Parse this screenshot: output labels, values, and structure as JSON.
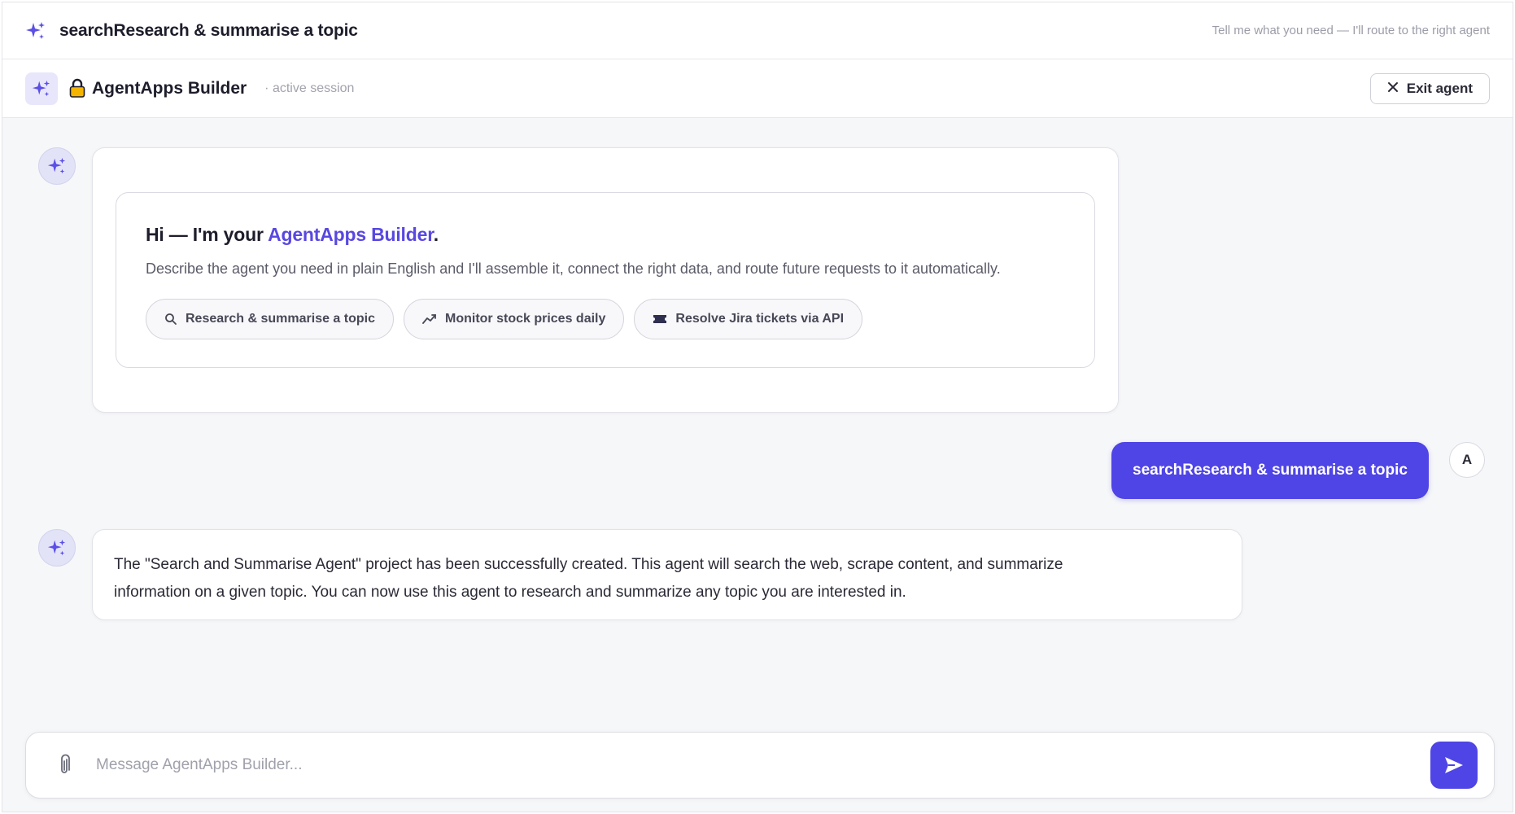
{
  "topbar": {
    "title": "searchResearch & summarise a topic",
    "hint": "Tell me what you need — I'll route to the right agent",
    "icon": "sparkle-icon"
  },
  "agentbar": {
    "agent_icon": "sparkle-icon",
    "lock_icon": "lock-icon",
    "name": "AgentApps Builder",
    "session": "· active session",
    "exit_label": "Exit agent",
    "exit_icon": "close-icon"
  },
  "welcome": {
    "title_prefix": "Hi — I'm your ",
    "title_accent": "AgentApps Builder",
    "title_suffix": ".",
    "description": "Describe the agent you need in plain English and I'll assemble it, connect the right data, and route future requests to it automatically.",
    "chips": [
      {
        "label": "Research & summarise a topic",
        "icon": "search-icon"
      },
      {
        "label": "Monitor stock prices daily",
        "icon": "trend-icon"
      },
      {
        "label": "Resolve Jira tickets via API",
        "icon": "ticket-icon"
      }
    ]
  },
  "conversation": {
    "user_avatar": "A",
    "user_message": "searchResearch & summarise a topic",
    "bot_reply_line1": "The \"Search and Summarise Agent\" project has been successfully created. This agent will search the web, scrape content, and summarize",
    "bot_reply_line2": "information on a given topic. You can now use this agent to research and summarize any topic you are interested in."
  },
  "composer": {
    "placeholder": "Message AgentApps Builder...",
    "value": "",
    "attach_icon": "paperclip-icon",
    "send_icon": "send-icon"
  },
  "colors": {
    "accent": "#4f44e5",
    "accent_text": "#5848e0",
    "avatar_bg": "#e3e3f7"
  }
}
